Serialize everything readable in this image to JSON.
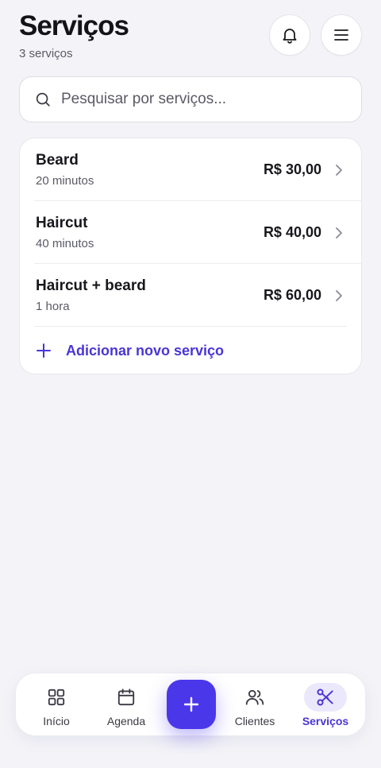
{
  "header": {
    "title": "Serviços",
    "subtitle": "3 serviços",
    "notifications_icon": "bell-icon",
    "menu_icon": "menu-icon"
  },
  "search": {
    "placeholder": "Pesquisar por serviços...",
    "value": ""
  },
  "services": [
    {
      "name": "Beard",
      "duration": "20 minutos",
      "price": "R$ 30,00"
    },
    {
      "name": "Haircut",
      "duration": "40 minutos",
      "price": "R$ 40,00"
    },
    {
      "name": "Haircut + beard",
      "duration": "1 hora",
      "price": "R$ 60,00"
    }
  ],
  "add_service": {
    "label": "Adicionar novo serviço"
  },
  "nav": {
    "items": [
      {
        "label": "Início",
        "icon": "grid-icon"
      },
      {
        "label": "Agenda",
        "icon": "calendar-icon"
      },
      {
        "label": "Clientes",
        "icon": "users-icon"
      },
      {
        "label": "Serviços",
        "icon": "scissors-icon"
      }
    ],
    "active": "Serviços",
    "fab_icon": "plus-icon"
  },
  "colors": {
    "accent": "#4b37ea",
    "accent_text": "#4a35d6",
    "active_pill": "#ebe8fb",
    "background": "#f4f4f8"
  }
}
